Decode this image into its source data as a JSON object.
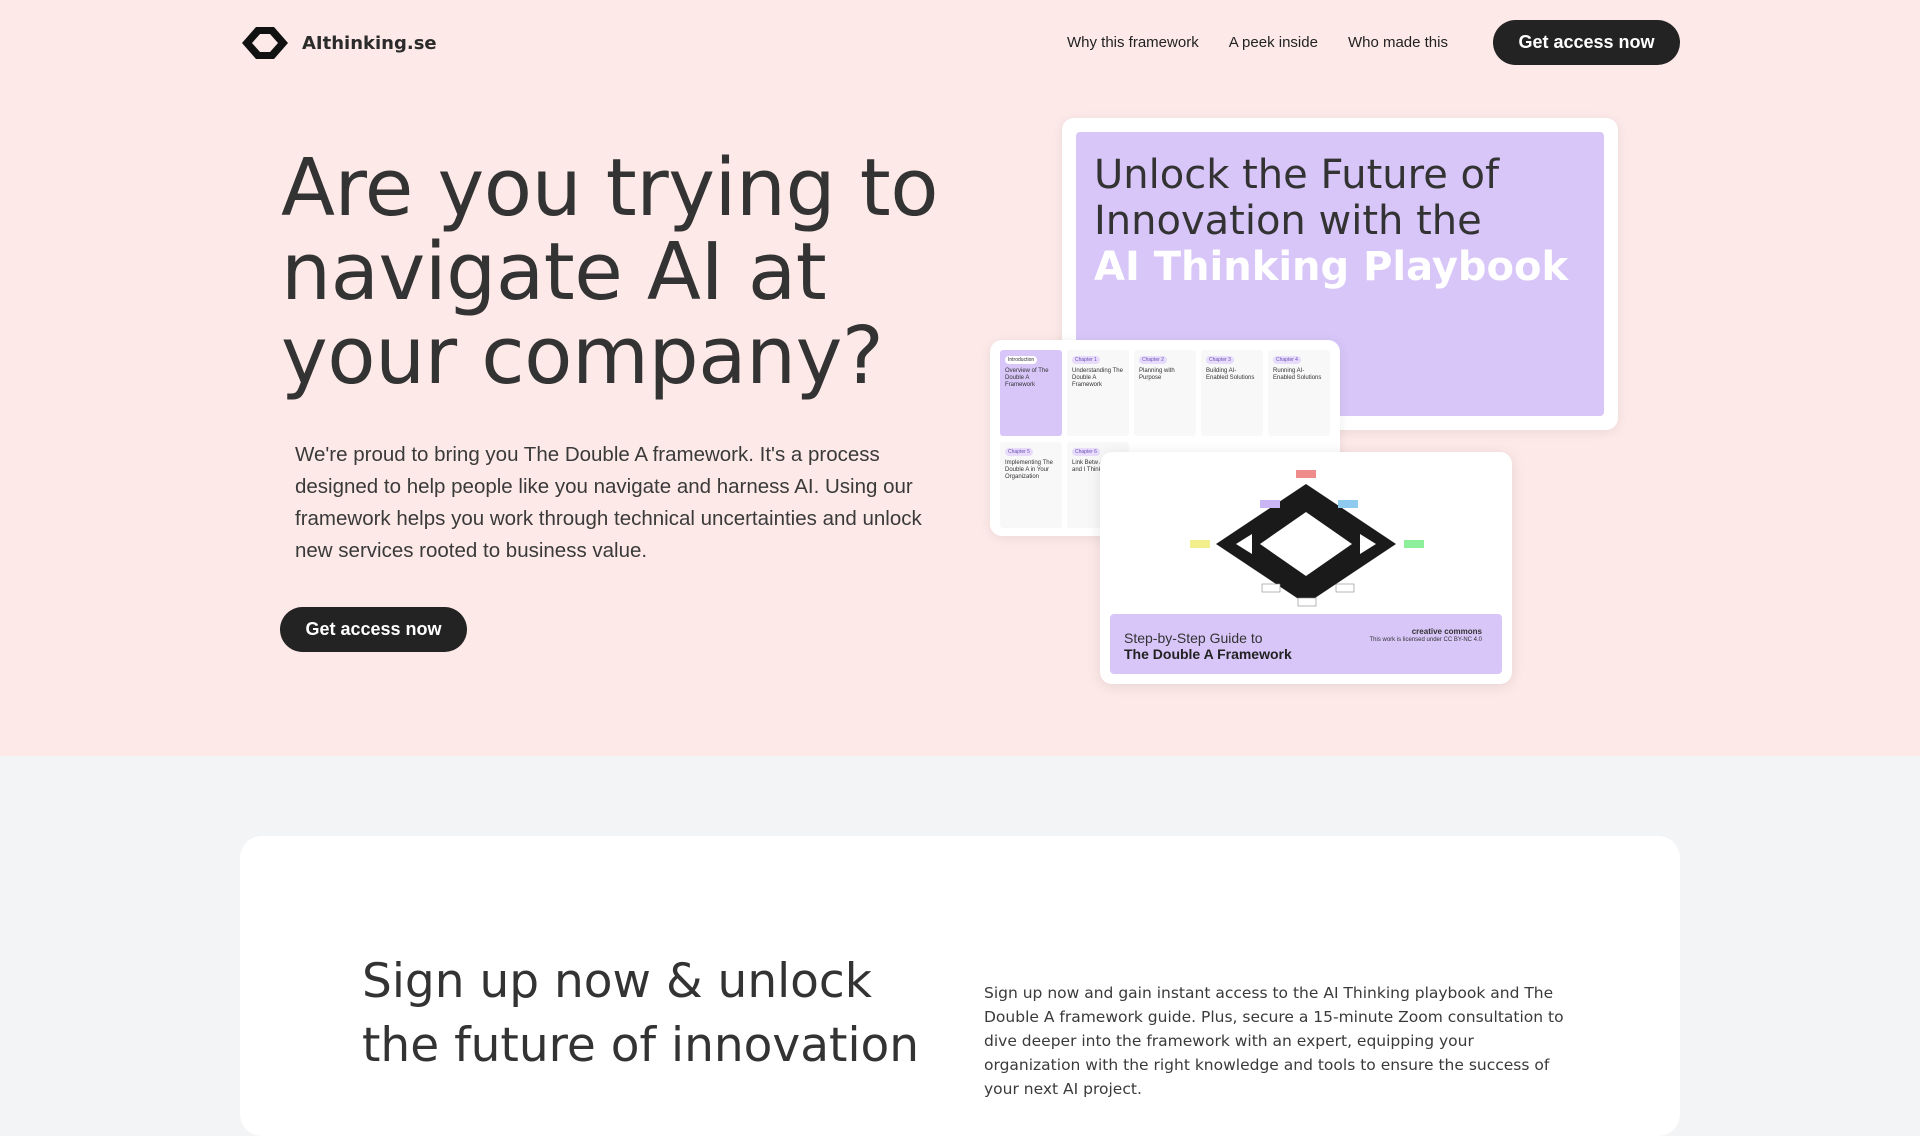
{
  "header": {
    "logo_text": "AIthinking.se",
    "nav": [
      "Why this framework",
      "A peek inside",
      "Who made this"
    ],
    "cta_label": "Get access now"
  },
  "hero": {
    "title": "Are you trying to navigate AI at your company?",
    "description": "We're proud to bring you The Double A framework. It's a process designed to help people like you navigate and harness AI. Using our framework helps you work through technical uncertainties and unlock new services rooted to business value.",
    "cta_label": "Get access now"
  },
  "mockup": {
    "cover_line1": "Unlock the Future of",
    "cover_line2": "Innovation with the",
    "cover_highlight": "AI Thinking Playbook",
    "chapters": [
      {
        "tag": "Introduction",
        "title": "Overview of The Double A Framework"
      },
      {
        "tag": "Chapter 1",
        "title": "Understanding The Double A Framework"
      },
      {
        "tag": "Chapter 2",
        "title": "Planning with Purpose"
      },
      {
        "tag": "Chapter 3",
        "title": "Building AI-Enabled Solutions"
      },
      {
        "tag": "Chapter 4",
        "title": "Running AI-Enabled Solutions"
      },
      {
        "tag": "Chapter 5",
        "title": "Implementing The Double A in Your Organization"
      },
      {
        "tag": "Chapter 6",
        "title": "Link Betw Agile and I Thinking"
      }
    ],
    "guide_subtitle": "Step-by-Step Guide to",
    "guide_title": "The Double A Framework",
    "license_brand": "creative commons",
    "license_text": "This work is licensed under CC BY-NC 4.0"
  },
  "signup": {
    "title": "Sign up now & unlock the future of innovation",
    "description": "Sign up now and gain instant access to the AI Thinking playbook and The Double A framework guide. Plus, secure a 15-minute Zoom consultation to dive deeper into the framework with an expert, equipping your organization with the right knowledge and tools to ensure the success of your next AI project."
  },
  "colors": {
    "hero_bg": "#fdeae8",
    "accent_purple": "#d8c6f9",
    "button_dark": "#232323",
    "page_bg": "#f3f4f6"
  }
}
